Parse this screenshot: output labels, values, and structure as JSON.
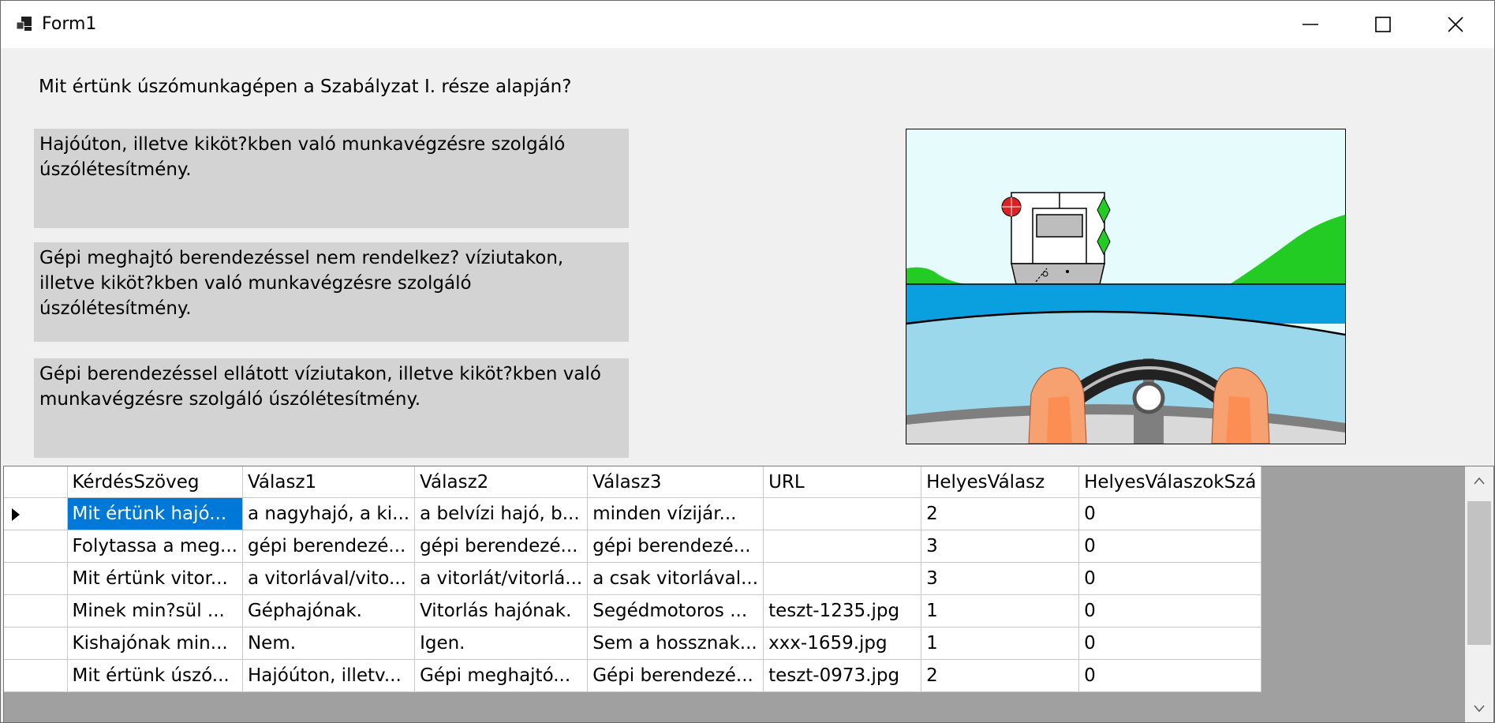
{
  "window": {
    "title": "Form1",
    "app_icon": "form-app-icon",
    "minimize_icon": "minimize-icon",
    "maximize_icon": "maximize-icon",
    "close_icon": "close-icon"
  },
  "quiz": {
    "question": "Mit értünk úszómunkagépen a Szabályzat I. része alapján?",
    "answers": [
      "Hajóúton, illetve kiköt?kben való munkavégzésre szolgáló úszólétesítmény.",
      "Gépi meghajtó berendezéssel nem rendelkez? víziutakon, illetve kiköt?kben való munkavégzésre szolgáló úszólétesítmény.",
      "Gépi berendezéssel ellátott víziutakon, illetve kiköt?kben való munkavégzésre szolgáló úszólétesítmény."
    ],
    "picture": "boat-steering-wheel-illustration"
  },
  "grid": {
    "columns": [
      "KérdésSzöveg",
      "Válasz1",
      "Válasz2",
      "Válasz3",
      "URL",
      "HelyesVálasz",
      "HelyesVálaszokSzá"
    ],
    "rows": [
      [
        "Mit értünk hajó...",
        "a nagyhajó, a ki...",
        "a belvízi hajó, b...",
        "minden vízijár...",
        "",
        "2",
        "0"
      ],
      [
        "Folytassa a meg...",
        "gépi berendezé...",
        "gépi berendezé...",
        "gépi berendezé...",
        "",
        "3",
        "0"
      ],
      [
        "Mit értünk vitor...",
        "a vitorlával/vito...",
        "a vitorlát/vitorlá...",
        "a csak vitorlával...",
        "",
        "3",
        "0"
      ],
      [
        "Minek min?sül ...",
        "Géphajónak.",
        "Vitorlás hajónak.",
        "Segédmotoros ...",
        "teszt-1235.jpg",
        "1",
        "0"
      ],
      [
        "Kishajónak min...",
        "Nem.",
        "Igen.",
        "Sem a hossznak...",
        "xxx-1659.jpg",
        "1",
        "0"
      ],
      [
        "Mit értünk úszó...",
        "Hajóúton, illetv...",
        "Gépi meghajtó...",
        "Gépi berendezé...",
        "teszt-0973.jpg",
        "2",
        "0"
      ]
    ],
    "current_row_indicator": "row-arrow-icon",
    "scroll_up_icon": "scroll-up-icon",
    "scroll_down_icon": "scroll-down-icon"
  }
}
